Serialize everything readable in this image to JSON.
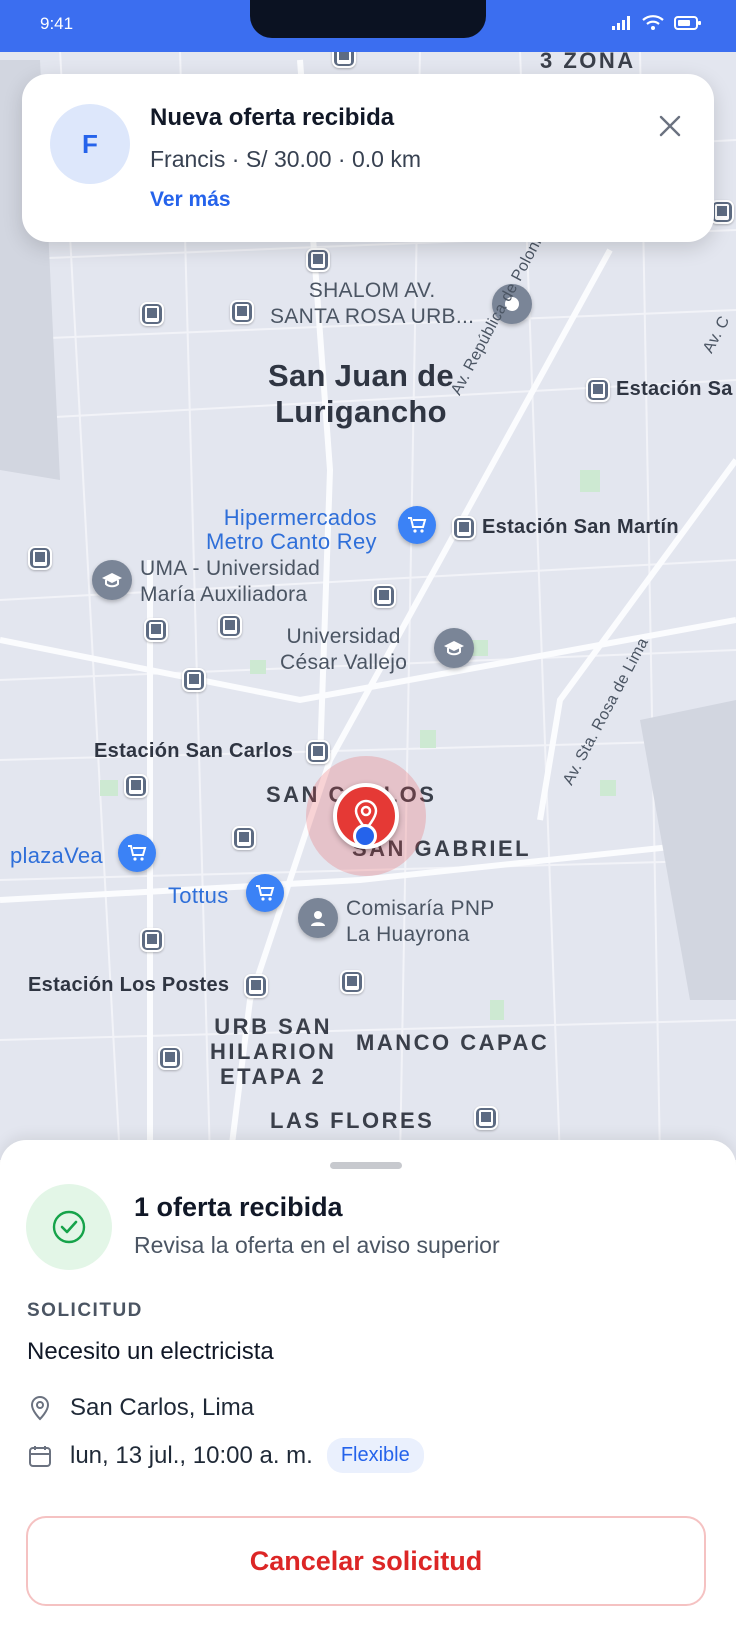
{
  "status_bar": {
    "time": "9:41"
  },
  "notification": {
    "avatar_letter": "F",
    "title": "Nueva oferta recibida",
    "subtitle": "Francis · S/ 30.00 · 0.0 km",
    "link": "Ver más",
    "close_icon": "close-icon"
  },
  "map": {
    "district_main": "San Juan de\nLurigancho",
    "districts": {
      "zona3": "3 ZONA",
      "san_carlos": "SAN CARLOS",
      "san_gabriel": "SAN GABRIEL",
      "urb_san_hilarion": "URB SAN\nHILARION\nETAPA 2",
      "manco_capac": "MANCO CAPAC",
      "las_flores": "LAS FLORES"
    },
    "pois": {
      "shalom": "SHALOM AV.\nSANTA ROSA URB...",
      "hipermercados": "Hipermercados\nMetro Canto Rey",
      "uma": "UMA - Universidad\nMaría Auxiliadora",
      "ucv": "Universidad\nCésar Vallejo",
      "plazavea": "plazaVea",
      "tottus": "Tottus",
      "comisaria": "Comisaría PNP\nLa Huayrona"
    },
    "stations": {
      "san_martin": "Estación San Martín",
      "san_carlos": "Estación San Carlos",
      "los_postes": "Estación Los Postes",
      "estacion_sa": "Estación Sa"
    },
    "roads": {
      "polonia": "Av. República de Polonia",
      "santa_rosa": "Av. Sta. Rosa de Lima",
      "av": "Av. C"
    }
  },
  "sheet": {
    "title": "1 oferta recibida",
    "subtitle": "Revisa la oferta en el aviso superior",
    "section_label": "SOLICITUD",
    "request": "Necesito un electricista",
    "location": "San Carlos, Lima",
    "datetime": "lun, 13 jul., 10:00 a. m.",
    "badge": "Flexible",
    "cancel_label": "Cancelar solicitud"
  },
  "colors": {
    "accent": "#2563eb",
    "status_bar": "#3b6ef0",
    "danger": "#dc2626",
    "success": "#16a34a",
    "map_bg": "#e3e6ef"
  }
}
